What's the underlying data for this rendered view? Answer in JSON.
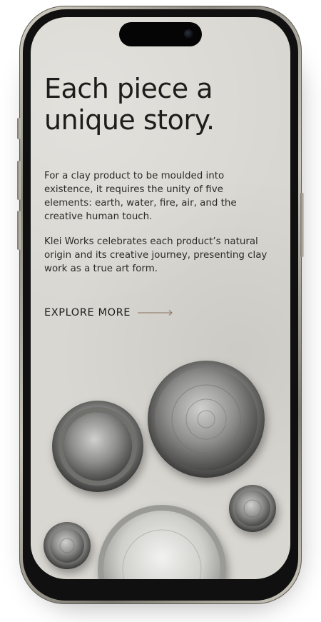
{
  "screen": {
    "headline": "Each piece a unique story.",
    "paragraph_1": "For a clay product to be moulded into existence, it requires the unity of five elements: earth, water, fire, air, and the creative human touch.",
    "paragraph_2": "Klei Works celebrates each product’s natural origin and its creative journey, presenting clay work as a true art form.",
    "cta_label": "EXPLORE MORE",
    "cta_icon": "arrow-right-icon",
    "image": "ceramic-bowls-photo"
  },
  "colors": {
    "background": "#d9d7d1",
    "text": "#1d1d1b",
    "accent_arrow": "#8a6f5c"
  }
}
